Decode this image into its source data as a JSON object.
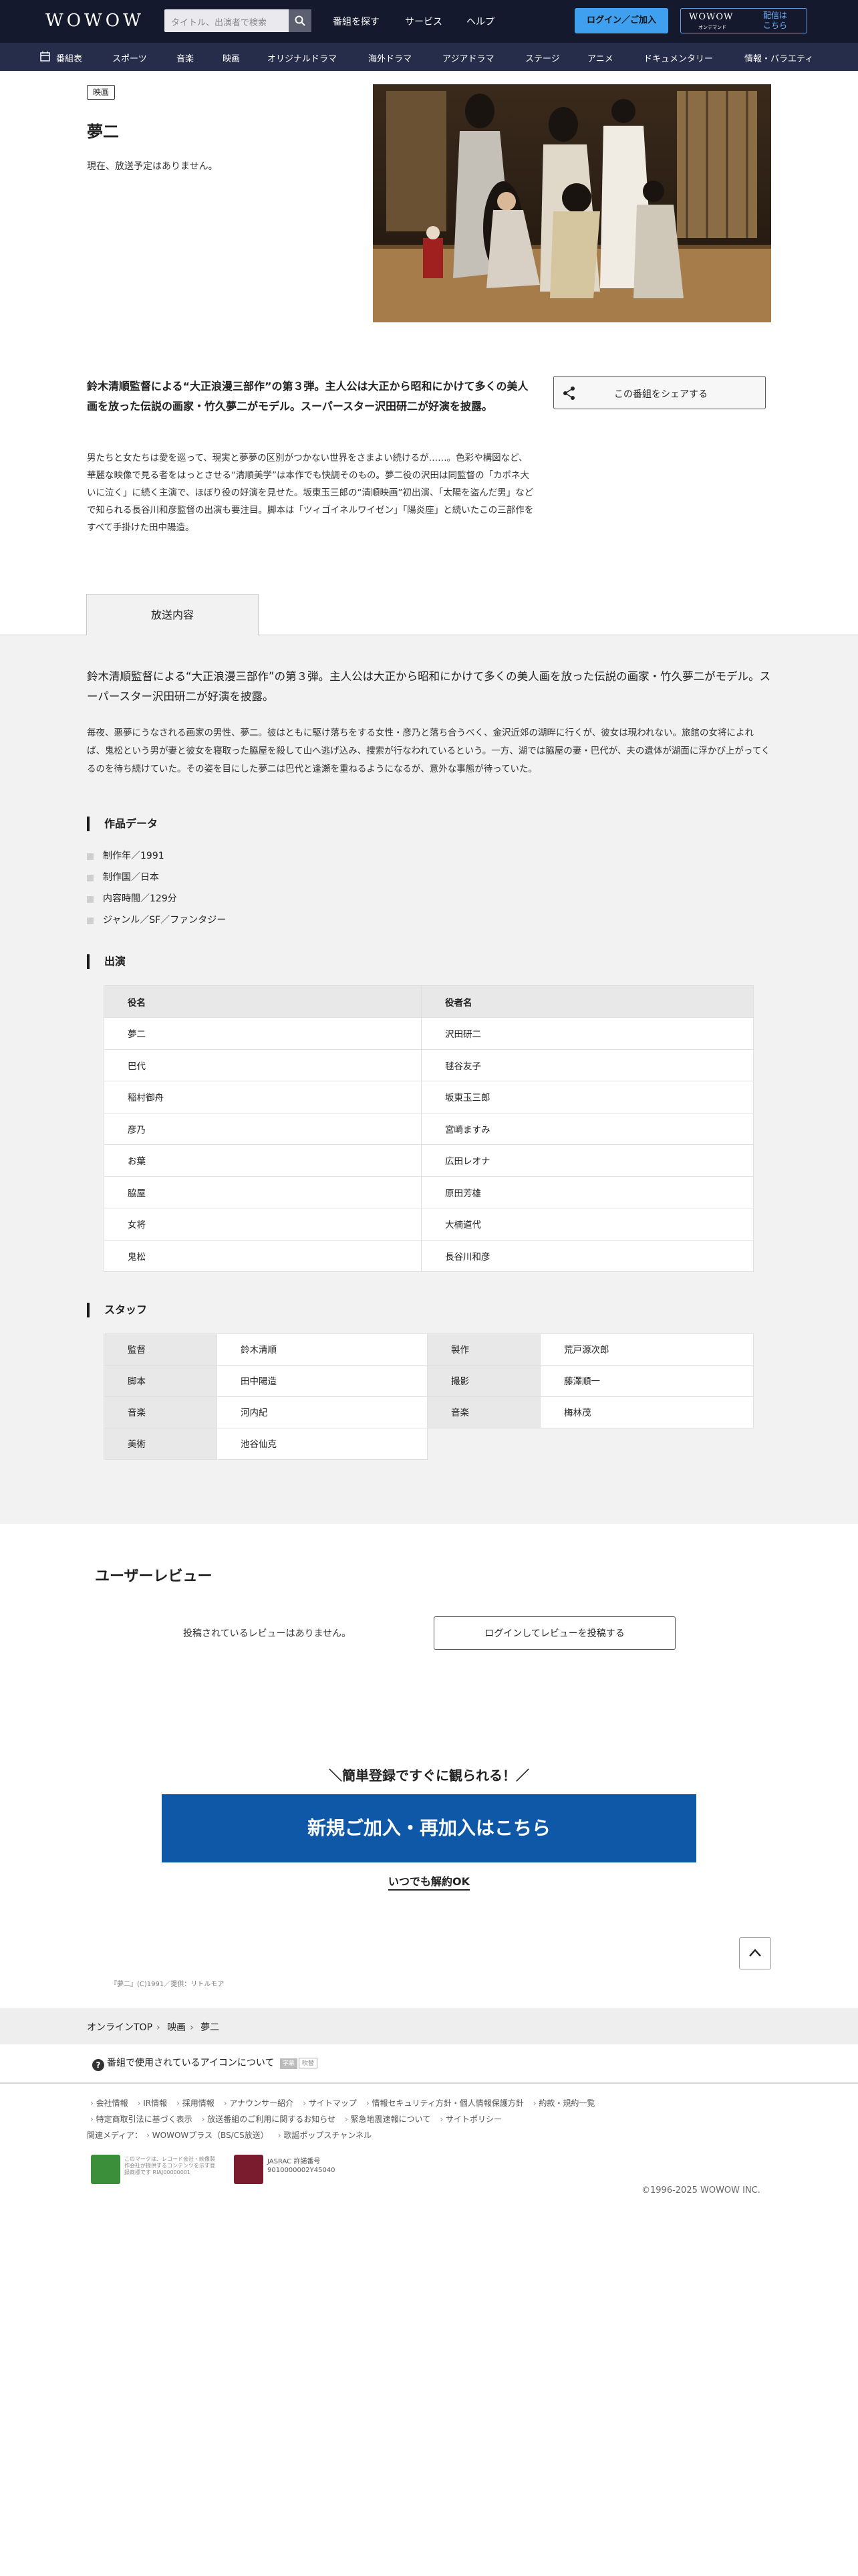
{
  "header": {
    "logo": "WOWOW",
    "search_placeholder": "タイトル、出演者で検索",
    "nav": [
      "番組を探す",
      "サービス",
      "ヘルプ"
    ],
    "login": "ログイン／ご加入",
    "ondemand_logo": "WOWOW",
    "ondemand_sub": "オンデマンド",
    "ondemand_text1": "配信は",
    "ondemand_text2": "こちら"
  },
  "categories": [
    "番組表",
    "スポーツ",
    "音楽",
    "映画",
    "オリジナルドラマ",
    "海外ドラマ",
    "アジアドラマ",
    "ステージ",
    "アニメ",
    "ドキュメンタリー",
    "情報・バラエティ"
  ],
  "program": {
    "tag": "映画",
    "title": "夢二",
    "no_air": "現在、放送予定はありません。",
    "lead": "鈴木清順監督による“大正浪漫三部作”の第３弾。主人公は大正から昭和にかけて多くの美人画を放った伝説の画家・竹久夢二がモデル。スーパースター沢田研二が好演を披露。",
    "share": "この番組をシェアする",
    "intro": "男たちと女たちは愛を巡って、現実と夢夢の区別がつかない世界をさまよい続けるが……。色彩や構図など、華麗な映像で見る者をはっとさせる“清順美学”は本作でも快調そのもの。夢二役の沢田は同監督の「カポネ大いに泣く」に続く主演で、ほぼり役の好演を見せた。坂東玉三郎の“清順映画”初出演、「太陽を盗んだ男」などで知られる長谷川和彦監督の出演も要注目。脚本は「ツィゴイネルワイゼン」「陽炎座」と続いたこの三部作をすべて手掛けた田中陽造。"
  },
  "tab_label": "放送内容",
  "synopsis_lead": "鈴木清順監督による“大正浪漫三部作”の第３弾。主人公は大正から昭和にかけて多くの美人画を放った伝説の画家・竹久夢二がモデル。スーパースター沢田研二が好演を披露。",
  "synopsis": "毎夜、悪夢にうなされる画家の男性、夢二。彼はともに駆け落ちをする女性・彦乃と落ち合うべく、金沢近郊の湖畔に行くが、彼女は現われない。旅館の女将によれば、鬼松という男が妻と彼女を寝取った脇屋を殺して山へ逃げ込み、捜索が行なわれているという。一方、湖では脇屋の妻・巴代が、夫の遺体が湖面に浮かび上がってくるのを待ち続けていた。その姿を目にした夢二は巴代と逢瀬を重ねるようになるが、意外な事態が待っていた。",
  "work_data": {
    "heading": "作品データ",
    "items": [
      "制作年／1991",
      "制作国／日本",
      "内容時間／129分",
      "ジャンル／SF／ファンタジー"
    ]
  },
  "cast": {
    "heading": "出演",
    "col_role": "役名",
    "col_actor": "役者名",
    "rows": [
      {
        "role": "夢二",
        "actor": "沢田研二"
      },
      {
        "role": "巴代",
        "actor": "毬谷友子"
      },
      {
        "role": "稲村御舟",
        "actor": "坂東玉三郎"
      },
      {
        "role": "彦乃",
        "actor": "宮崎ますみ"
      },
      {
        "role": "お葉",
        "actor": "広田レオナ"
      },
      {
        "role": "脇屋",
        "actor": "原田芳雄"
      },
      {
        "role": "女将",
        "actor": "大楠道代"
      },
      {
        "role": "鬼松",
        "actor": "長谷川和彦"
      }
    ]
  },
  "staff": {
    "heading": "スタッフ",
    "items": [
      {
        "key": "監督",
        "value": "鈴木清順"
      },
      {
        "key": "製作",
        "value": "荒戸源次郎"
      },
      {
        "key": "脚本",
        "value": "田中陽造"
      },
      {
        "key": "撮影",
        "value": "藤澤順一"
      },
      {
        "key": "音楽",
        "value": "河内紀"
      },
      {
        "key": "音楽",
        "value": "梅林茂"
      },
      {
        "key": "美術",
        "value": "池谷仙克"
      }
    ]
  },
  "review": {
    "heading": "ユーザーレビュー",
    "none": "投稿されているレビューはありません。",
    "button": "ログインしてレビューを投稿する"
  },
  "signup": {
    "catch": "＼簡単登録ですぐに観られる！／",
    "cta": "新規ご加入・再加入はこちら",
    "cancel": "いつでも解約OK"
  },
  "credit": "『夢二』(C)1991／提供：リトルモア",
  "breadcrumb": [
    "オンラインTOP",
    "映画",
    "夢二"
  ],
  "icon_info": "番組で使用されているアイコンについて",
  "icon_badges": [
    "字幕",
    "吹替"
  ],
  "footer_links": {
    "row1": [
      "会社情報",
      "IR情報",
      "採用情報",
      "アナウンサー紹介",
      "サイトマップ",
      "情報セキュリティ方針・個人情報保護方針",
      "約款・規約一覧"
    ],
    "row2": [
      "特定商取引法に基づく表示",
      "放送番組のご利用に関するお知らせ",
      "緊急地震速報について",
      "サイトポリシー"
    ],
    "row3": [
      "関連メディア：",
      "WOWOWプラス（BS/CS放送）",
      "歌謡ポップスチャンネル"
    ]
  },
  "badge1_text": "このマークは、レコード会社・映像製作会社が提供するコンテンツを示す登録商標です RIAJ00000001",
  "badge2_text1": "JASRAC 許諾番号",
  "badge2_text2": "9010000002Y45040",
  "copyright": "©1996-2025 WOWOW INC."
}
